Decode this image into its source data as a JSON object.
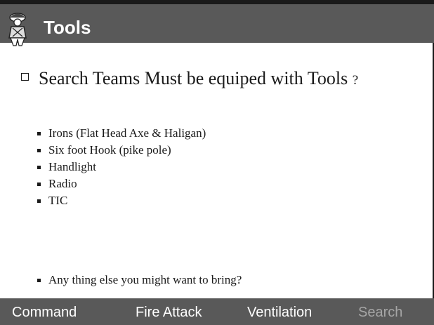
{
  "title": "Tools",
  "main_bullet": {
    "text": "Search Teams Must be equiped with Tools",
    "suffix": "?"
  },
  "tools": [
    "Irons  (Flat Head Axe & Haligan)",
    "Six foot Hook (pike pole)",
    "Handlight",
    "Radio",
    "TIC"
  ],
  "extra_question": "Any thing else you might want to bring?",
  "nav": {
    "command": "Command",
    "fire_attack": "Fire Attack",
    "ventilation": "Ventilation",
    "search": "Search"
  },
  "colors": {
    "title_bar": "#595959",
    "nav_active": "#ffffff",
    "nav_inactive": "#a6a6a6"
  }
}
